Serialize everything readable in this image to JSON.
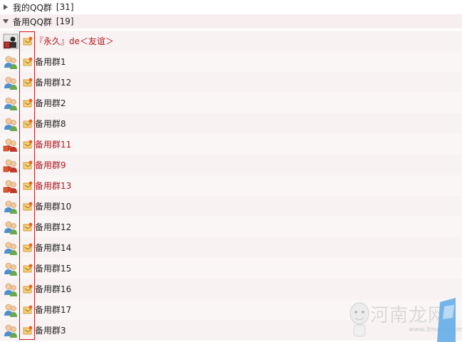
{
  "groups": {
    "collapsed": {
      "name": "我的QQ群",
      "count": "[31]"
    },
    "expanded": {
      "name": "备用QQ群",
      "count": "[19]"
    }
  },
  "rows": [
    {
      "label": "『永久』de＜友谊＞",
      "color": "red",
      "avatar": "custom"
    },
    {
      "label": "备用群1",
      "color": "black",
      "avatar": "blue"
    },
    {
      "label": "备用群12",
      "color": "black",
      "avatar": "blue"
    },
    {
      "label": "备用群2",
      "color": "black",
      "avatar": "blue"
    },
    {
      "label": "备用群8",
      "color": "black",
      "avatar": "blue"
    },
    {
      "label": "备用群11",
      "color": "red",
      "avatar": "red"
    },
    {
      "label": "备用群9",
      "color": "red",
      "avatar": "red"
    },
    {
      "label": "备用群13",
      "color": "red",
      "avatar": "red"
    },
    {
      "label": "备用群10",
      "color": "black",
      "avatar": "blue"
    },
    {
      "label": "备用群12",
      "color": "black",
      "avatar": "blue"
    },
    {
      "label": "备用群14",
      "color": "black",
      "avatar": "blue"
    },
    {
      "label": "备用群15",
      "color": "black",
      "avatar": "blue"
    },
    {
      "label": "备用群16",
      "color": "black",
      "avatar": "blue"
    },
    {
      "label": "备用群17",
      "color": "black",
      "avatar": "blue"
    },
    {
      "label": "备用群3",
      "color": "black",
      "avatar": "blue"
    }
  ],
  "watermark": {
    "text": "河南龙网",
    "url": "www.3mama.com"
  },
  "colors": {
    "red_text": "#b0171f",
    "highlight": "#d11a1a"
  }
}
